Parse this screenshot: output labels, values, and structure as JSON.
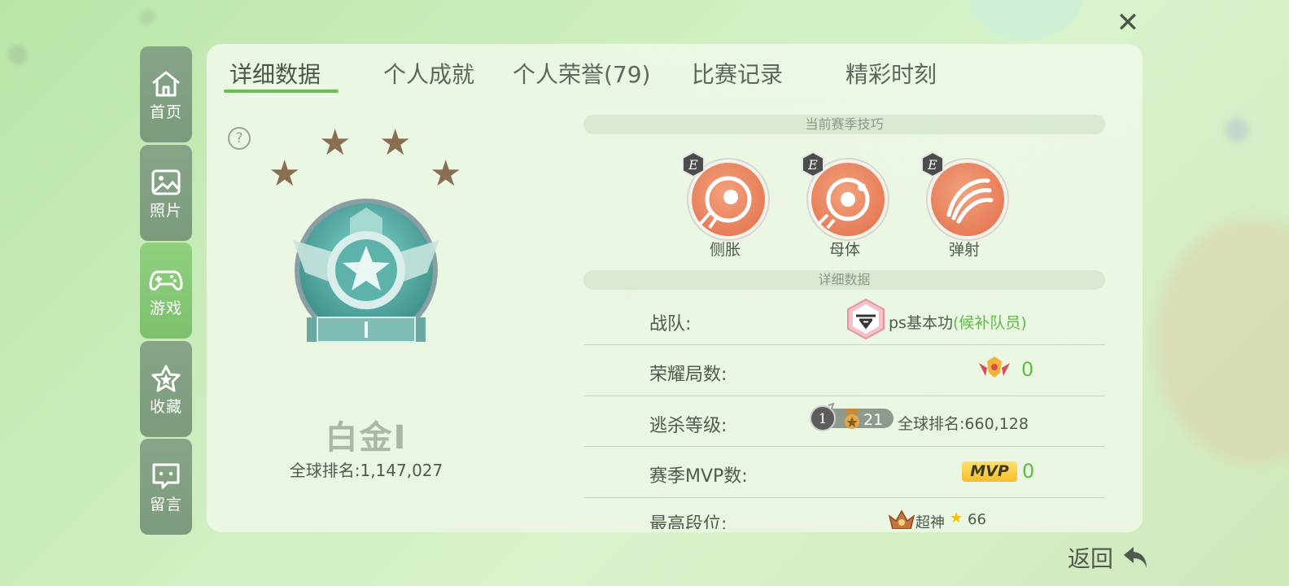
{
  "close_icon": "close-x",
  "sidebar": [
    {
      "label": "首页",
      "icon": "home-icon"
    },
    {
      "label": "照片",
      "icon": "photo-icon"
    },
    {
      "label": "游戏",
      "icon": "gamepad-icon",
      "active": true
    },
    {
      "label": "收藏",
      "icon": "star-icon"
    },
    {
      "label": "留言",
      "icon": "message-icon"
    }
  ],
  "tabs": [
    "详细数据",
    "个人成就",
    "个人荣誉(79)",
    "比赛记录",
    "精彩时刻"
  ],
  "rank": {
    "name": "白金Ⅰ",
    "global_rank": "全球排名:1,147,027",
    "stars_filled": 4,
    "tier_numeral": "Ⅰ"
  },
  "skills_section": {
    "title": "当前赛季技巧",
    "items": [
      {
        "label": "侧胀",
        "grade": "E"
      },
      {
        "label": "母体",
        "grade": "E"
      },
      {
        "label": "弹射",
        "grade": "E"
      }
    ]
  },
  "details_section": {
    "title": "详细数据",
    "team_label": "战队:",
    "team_name": "ps基本功",
    "team_role": "(候补队员)",
    "glory_label": "荣耀局数:",
    "glory_value": "0",
    "escape_label": "逃杀等级:",
    "escape_badge_num": "1",
    "escape_level": "21",
    "escape_rank": "全球排名:660,128",
    "mvp_label": "赛季MVP数:",
    "mvp_badge": "MVP",
    "mvp_value": "0",
    "highest_label": "最高段位:",
    "highest_value": "超神",
    "highest_stars": "66"
  },
  "back_label": "返回",
  "colors": {
    "accent_green": "#6cbf58",
    "skill_orange": "#e26f4a",
    "mvp_yellow": "#f6bd2b",
    "sidebar_active": "#8fd07f",
    "sidebar_inactive": "#7b9b7c"
  }
}
